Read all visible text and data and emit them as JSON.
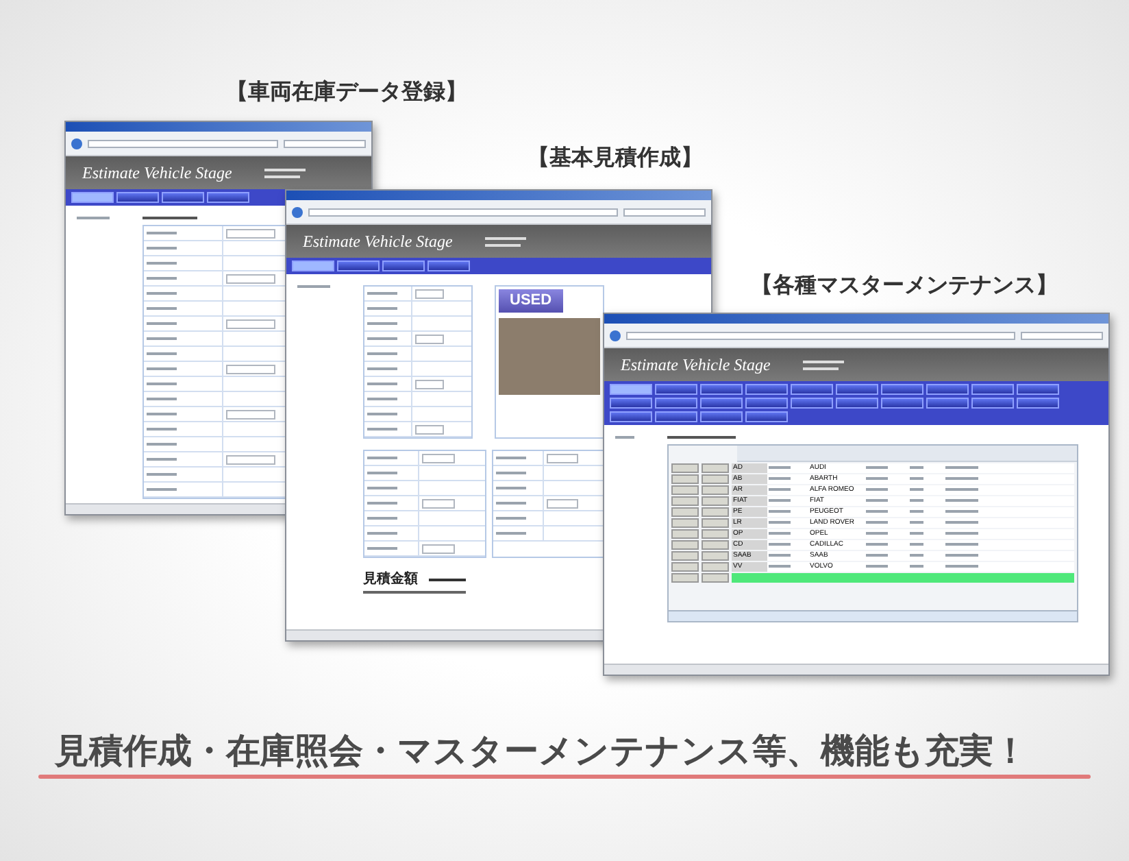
{
  "sections": [
    {
      "heading": "【車両在庫データ登録】"
    },
    {
      "heading": "【基本見積作成】"
    },
    {
      "heading": "【各種マスターメンテナンス】"
    }
  ],
  "windows": [
    {
      "kind": "stock",
      "app_title": "Estimate Vehicle Stage",
      "nav": [
        [
          {
            "selected": true
          },
          {
            "selected": false
          },
          {
            "selected": false
          },
          {
            "selected": false
          }
        ]
      ]
    },
    {
      "kind": "estimate",
      "app_title": "Estimate Vehicle Stage",
      "nav": [
        [
          {
            "selected": true
          },
          {
            "selected": false
          },
          {
            "selected": false
          },
          {
            "selected": false
          }
        ]
      ],
      "badge": "USED",
      "total_label": "見積金額"
    },
    {
      "kind": "master",
      "app_title": "Estimate Vehicle Stage",
      "nav": [
        [
          {
            "selected": true
          },
          {
            "selected": false
          },
          {
            "selected": false
          },
          {
            "selected": false
          },
          {
            "selected": false
          },
          {
            "selected": false
          },
          {
            "selected": false
          },
          {
            "selected": false
          },
          {
            "selected": false
          },
          {
            "selected": false
          }
        ],
        [
          {
            "selected": false
          },
          {
            "selected": false
          },
          {
            "selected": false
          },
          {
            "selected": false
          },
          {
            "selected": false
          },
          {
            "selected": false
          },
          {
            "selected": false
          },
          {
            "selected": false
          },
          {
            "selected": false
          },
          {
            "selected": false
          }
        ],
        [
          {
            "selected": false
          },
          {
            "selected": false
          },
          {
            "selected": false
          },
          {
            "selected": false
          }
        ]
      ],
      "rows": [
        {
          "kind": "entry",
          "code": "AD",
          "name_en": "AUDI"
        },
        {
          "kind": "entry",
          "code": "AB",
          "name_en": "ABARTH"
        },
        {
          "kind": "entry",
          "code": "AR",
          "name_en": "ALFA ROMEO"
        },
        {
          "kind": "entry",
          "code": "FIAT",
          "name_en": "FIAT"
        },
        {
          "kind": "entry",
          "code": "PE",
          "name_en": "PEUGEOT"
        },
        {
          "kind": "entry",
          "code": "LR",
          "name_en": "LAND ROVER"
        },
        {
          "kind": "entry",
          "code": "OP",
          "name_en": "OPEL"
        },
        {
          "kind": "entry",
          "code": "CD",
          "name_en": "CADILLAC"
        },
        {
          "kind": "entry",
          "code": "SAAB",
          "name_en": "SAAB"
        },
        {
          "kind": "entry",
          "code": "VV",
          "name_en": "VOLVO"
        },
        {
          "kind": "new"
        }
      ]
    }
  ],
  "caption": "見積作成・在庫照会・マスターメンテナンス等、機能も充実！"
}
